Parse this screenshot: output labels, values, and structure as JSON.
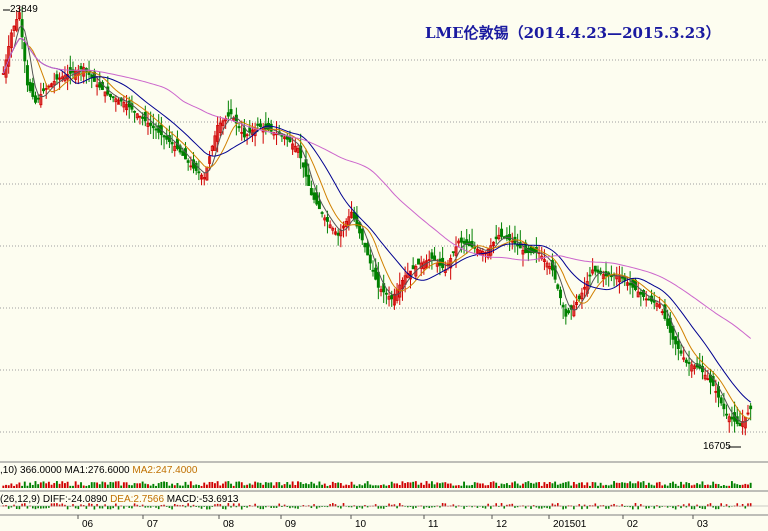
{
  "chart_data": {
    "type": "candlestick",
    "title": "LME伦敦锡（2014.4.23—2015.3.23）",
    "x_ticks": [
      "06",
      "07",
      "08",
      "09",
      "10",
      "11",
      "12",
      "201501",
      "02",
      "03"
    ],
    "high_label": "23849",
    "low_label": "16705",
    "ylim": [
      16200,
      24000
    ],
    "price_path": [
      [
        0,
        22800
      ],
      [
        3,
        23500
      ],
      [
        6,
        23849
      ],
      [
        9,
        22600
      ],
      [
        12,
        22300
      ],
      [
        15,
        22500
      ],
      [
        20,
        22700
      ],
      [
        25,
        22800
      ],
      [
        30,
        22900
      ],
      [
        35,
        22600
      ],
      [
        40,
        22400
      ],
      [
        45,
        22300
      ],
      [
        50,
        22100
      ],
      [
        55,
        21900
      ],
      [
        60,
        21700
      ],
      [
        65,
        21500
      ],
      [
        70,
        21200
      ],
      [
        75,
        21000
      ],
      [
        80,
        21900
      ],
      [
        85,
        22100
      ],
      [
        90,
        21700
      ],
      [
        95,
        21900
      ],
      [
        100,
        21800
      ],
      [
        105,
        21700
      ],
      [
        110,
        21500
      ],
      [
        115,
        20700
      ],
      [
        120,
        20300
      ],
      [
        125,
        20000
      ],
      [
        130,
        20400
      ],
      [
        135,
        19800
      ],
      [
        140,
        19100
      ],
      [
        145,
        18900
      ],
      [
        150,
        19300
      ],
      [
        155,
        19500
      ],
      [
        160,
        19600
      ],
      [
        165,
        19400
      ],
      [
        170,
        19900
      ],
      [
        175,
        19800
      ],
      [
        180,
        19700
      ],
      [
        185,
        20000
      ],
      [
        190,
        19900
      ],
      [
        195,
        19700
      ],
      [
        200,
        19700
      ],
      [
        205,
        19400
      ],
      [
        210,
        18600
      ],
      [
        215,
        18900
      ],
      [
        220,
        19400
      ],
      [
        225,
        19300
      ],
      [
        230,
        19300
      ],
      [
        235,
        19100
      ],
      [
        240,
        18900
      ],
      [
        245,
        18800
      ],
      [
        250,
        18200
      ],
      [
        255,
        17800
      ],
      [
        260,
        17700
      ],
      [
        265,
        17400
      ],
      [
        270,
        16900
      ],
      [
        275,
        16705
      ],
      [
        279,
        17000
      ]
    ],
    "legend": {
      "vol_prefix": ",10)",
      "vol_value": "366.0000",
      "ma1": "MA1:276.6000",
      "ma2": "MA2:247.4000",
      "macd_prefix": "(26,12,9)",
      "diff": "DIFF:-24.0890",
      "dea": "DEA:2.7566",
      "macd": "MACD:-53.6913"
    },
    "colors": {
      "up": "#d00000",
      "down": "#008000",
      "ma5": "#555555",
      "ma10": "#d08000",
      "ma20": "#000090",
      "ma60": "#cc66cc",
      "grid": "#a0a0a0",
      "title": "#1a1aa0",
      "background": "#fdfdf0"
    }
  }
}
